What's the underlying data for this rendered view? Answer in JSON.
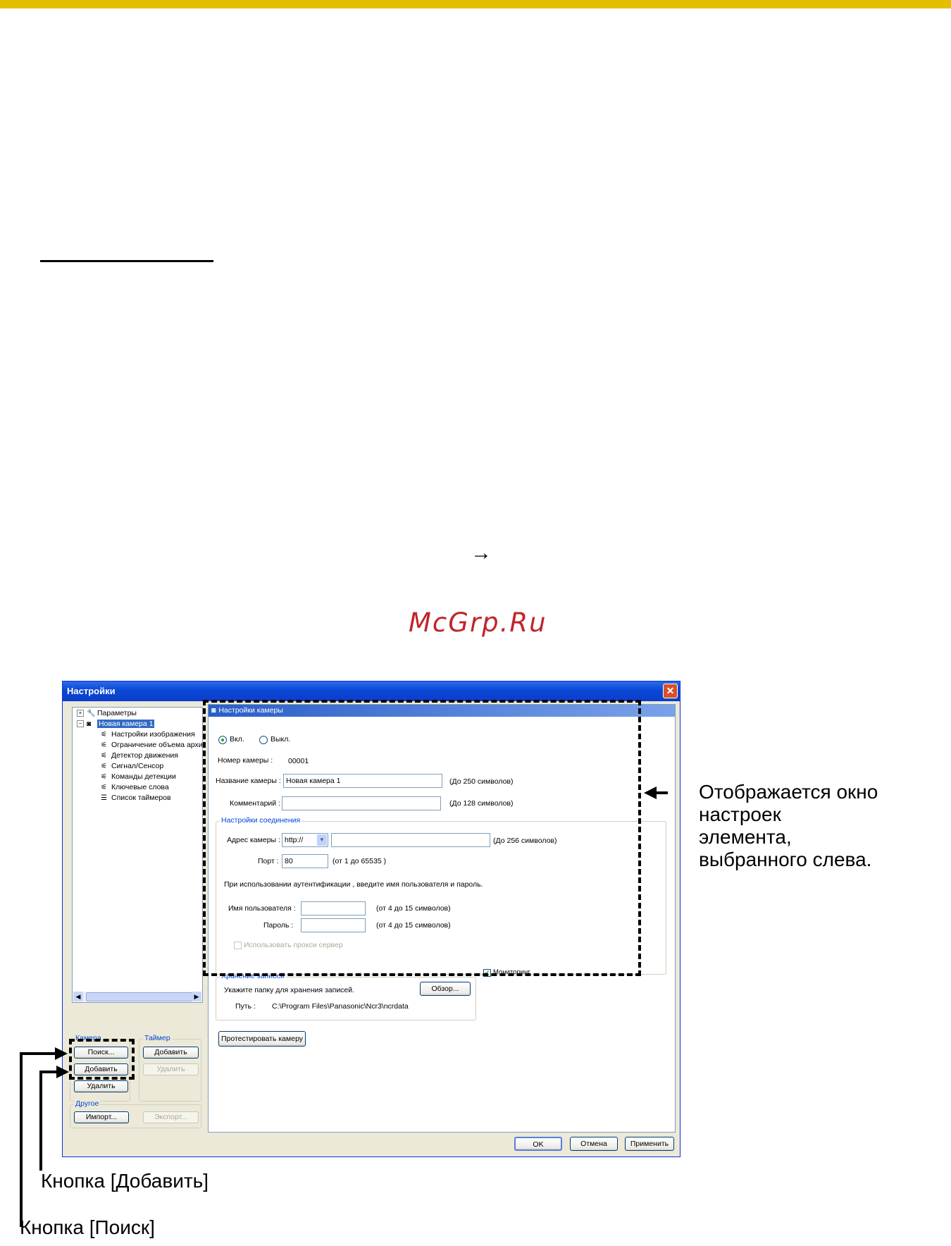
{
  "page": {
    "arrow_glyph": "→",
    "watermark": "McGrp.Ru"
  },
  "dialog": {
    "title": "Настройки",
    "close_icon": "✕",
    "tree": {
      "root_params": "Параметры",
      "camera": "Новая камера 1",
      "children": [
        "Настройки изображения",
        "Ограничение объема архи",
        "Детектор движения",
        "Сигнал/Сенсор",
        "Команды детекции",
        "Ключевые слова",
        "Список таймеров"
      ]
    },
    "camera_group": {
      "label": "Камера",
      "search": "Поиск...",
      "add": "Добавить",
      "delete": "Удалить"
    },
    "timer_group": {
      "label": "Таймер",
      "add": "Добавить",
      "delete": "Удалить"
    },
    "other_group": {
      "label": "Другое",
      "import": "Импорт...",
      "export": "Экспорт..."
    },
    "panel": {
      "header": "Настройки камеры",
      "on": "Вкл.",
      "off": "Выкл.",
      "camera_number_label": "Номер камеры :",
      "camera_number": "00001",
      "camera_name_label": "Название камеры :",
      "camera_name": "Новая камера 1",
      "camera_name_hint": "(До 250 символов)",
      "comment_label": "Комментарий :",
      "comment_value": "",
      "comment_hint": "(До 128 символов)",
      "connection_group": "Настройки соединения",
      "address_label": "Адрес камеры :",
      "protocol": "http://",
      "address_value": "",
      "address_hint": "(До 256 символов)",
      "port_label": "Порт :",
      "port_value": "80",
      "port_hint": "(от  1 до 65535 )",
      "auth_note": "При использовании аутентификации , введите имя пользователя и пароль.",
      "user_label": "Имя пользователя :",
      "user_value": "",
      "user_hint": "(от 4 до 15 символов)",
      "password_label": "Пароль :",
      "password_value": "",
      "password_hint": "(от 4 до 15 символов)",
      "proxy_label": "Использовать прокси сервер",
      "monitoring_label": "Мониторинг",
      "storage_group": "Хранение записей",
      "storage_note": "Укажите папку для хранения записей.",
      "browse": "Обзор...",
      "path_label": "Путь :",
      "path_value": "C:\\Program Files\\Panasonic\\Ncr3\\ncrdata",
      "test_camera": "Протестировать камеру"
    },
    "footer": {
      "ok": "OK",
      "cancel": "Отмена",
      "apply": "Применить"
    }
  },
  "annotations": {
    "right": [
      "Отображается окно",
      "настроек",
      "элемента,",
      "выбранного слева."
    ],
    "add_button": "Кнопка [Добавить]",
    "search_button": "Кнопка [Поиск]"
  }
}
